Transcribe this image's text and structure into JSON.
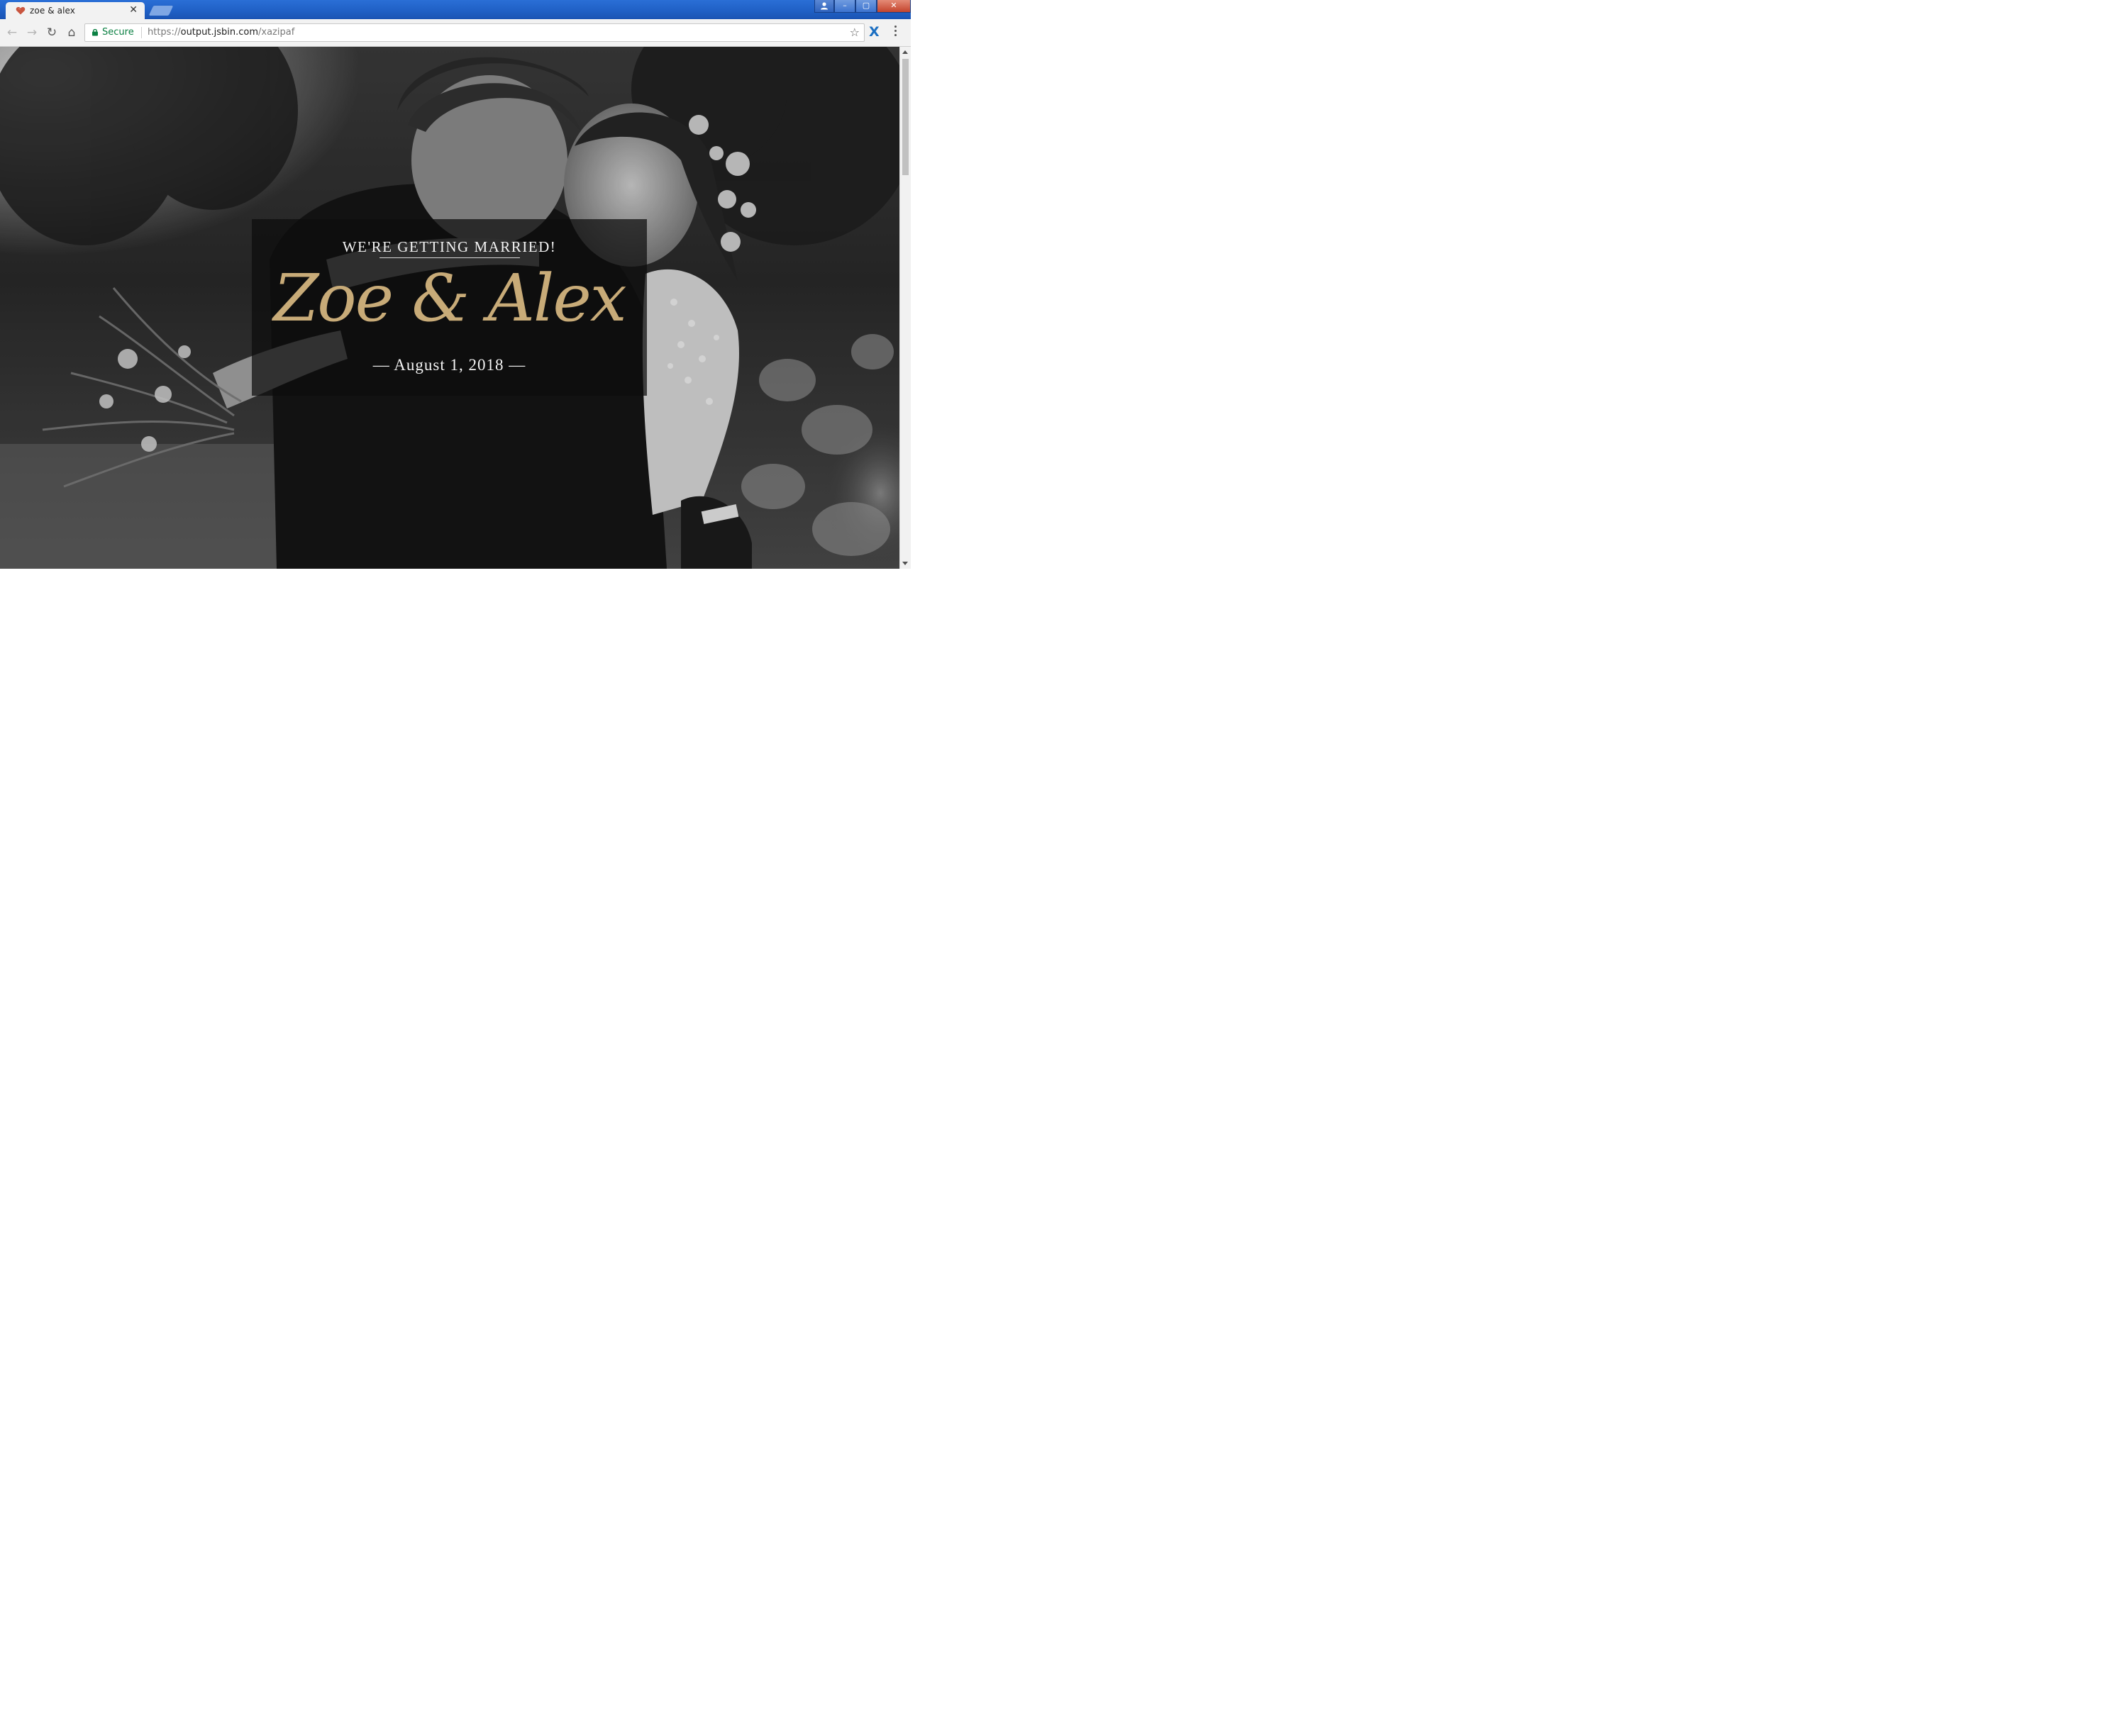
{
  "browser": {
    "tab": {
      "title": "zoe & alex",
      "close_glyph": "✕"
    },
    "window_controls": {
      "minimize": "–",
      "maximize": "▢",
      "close": "✕"
    },
    "toolbar": {
      "back_glyph": "←",
      "forward_glyph": "→",
      "reload_glyph": "↻",
      "home_glyph": "⌂",
      "secure_label": "Secure",
      "url_scheme": "https://",
      "url_host": "output.jsbin.com",
      "url_path": "/xazipaf",
      "bookmark_glyph": "☆",
      "extension_glyph": "X"
    }
  },
  "hero": {
    "eyebrow": "WE'RE GETTING MARRIED!",
    "names": "Zoe & Alex",
    "date": "— August 1, 2018 —",
    "name_color": "#c8ab78"
  }
}
